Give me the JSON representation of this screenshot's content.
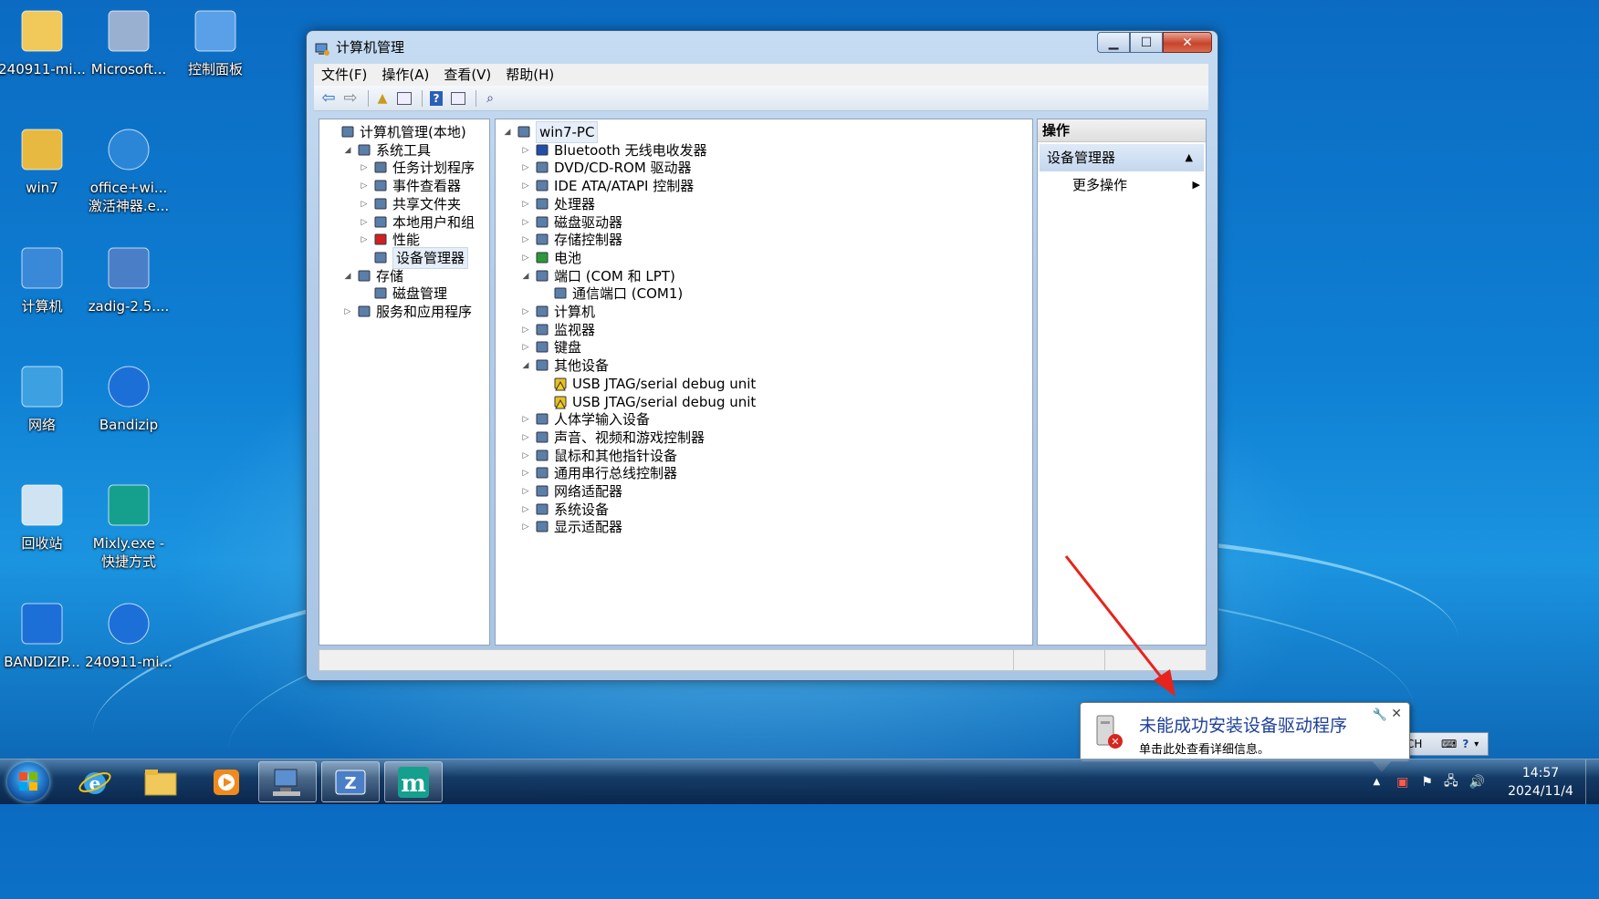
{
  "desktop": {
    "icons": [
      {
        "label": "240911-mi...",
        "icon": "folder-icon"
      },
      {
        "label": "Microsoft...",
        "icon": "cd-installer-icon"
      },
      {
        "label": "控制面板",
        "icon": "control-panel-icon"
      },
      {
        "label": "win7",
        "icon": "user-folder-icon"
      },
      {
        "label": "office+wi...",
        "label2": "激活神器.e...",
        "icon": "shield-icon"
      },
      {
        "label": "计算机",
        "icon": "computer-icon"
      },
      {
        "label": "zadig-2.5....",
        "icon": "zadig-icon"
      },
      {
        "label": "网络",
        "icon": "network-icon"
      },
      {
        "label": "Bandizip",
        "icon": "bandizip-icon"
      },
      {
        "label": "回收站",
        "icon": "recycle-bin-icon"
      },
      {
        "label": "Mixly.exe -",
        "label2": "快捷方式",
        "icon": "mixly-icon"
      },
      {
        "label": "BANDIZIP...",
        "icon": "bandizip-setup-icon"
      },
      {
        "label": "240911-mi...",
        "icon": "zip-icon"
      }
    ]
  },
  "window": {
    "title": "计算机管理",
    "menu": [
      "文件(F)",
      "操作(A)",
      "查看(V)",
      "帮助(H)"
    ],
    "left_tree": [
      {
        "label": "计算机管理(本地)",
        "level": 0,
        "expander": "",
        "icon": "computer-management-icon"
      },
      {
        "label": "系统工具",
        "level": 1,
        "expander": "◢",
        "icon": "tools-icon"
      },
      {
        "label": "任务计划程序",
        "level": 2,
        "expander": "▷",
        "icon": "clock-icon"
      },
      {
        "label": "事件查看器",
        "level": 2,
        "expander": "▷",
        "icon": "event-viewer-icon"
      },
      {
        "label": "共享文件夹",
        "level": 2,
        "expander": "▷",
        "icon": "shared-folder-icon"
      },
      {
        "label": "本地用户和组",
        "level": 2,
        "expander": "▷",
        "icon": "users-icon"
      },
      {
        "label": "性能",
        "level": 2,
        "expander": "▷",
        "icon": "performance-icon"
      },
      {
        "label": "设备管理器",
        "level": 2,
        "expander": "",
        "icon": "device-manager-icon",
        "selected": true
      },
      {
        "label": "存储",
        "level": 1,
        "expander": "◢",
        "icon": "storage-icon"
      },
      {
        "label": "磁盘管理",
        "level": 2,
        "expander": "",
        "icon": "disk-icon"
      },
      {
        "label": "服务和应用程序",
        "level": 1,
        "expander": "▷",
        "icon": "services-icon"
      }
    ],
    "device_tree": [
      {
        "label": "win7-PC",
        "level": 0,
        "expander": "◢",
        "icon": "computer-icon",
        "selected": true
      },
      {
        "label": "Bluetooth 无线电收发器",
        "level": 1,
        "expander": "▷",
        "icon": "bluetooth-icon"
      },
      {
        "label": "DVD/CD-ROM 驱动器",
        "level": 1,
        "expander": "▷",
        "icon": "dvd-drive-icon"
      },
      {
        "label": "IDE ATA/ATAPI 控制器",
        "level": 1,
        "expander": "▷",
        "icon": "ide-controller-icon"
      },
      {
        "label": "处理器",
        "level": 1,
        "expander": "▷",
        "icon": "processor-icon"
      },
      {
        "label": "磁盘驱动器",
        "level": 1,
        "expander": "▷",
        "icon": "disk-drive-icon"
      },
      {
        "label": "存储控制器",
        "level": 1,
        "expander": "▷",
        "icon": "storage-controller-icon"
      },
      {
        "label": "电池",
        "level": 1,
        "expander": "▷",
        "icon": "battery-icon"
      },
      {
        "label": "端口 (COM 和 LPT)",
        "level": 1,
        "expander": "◢",
        "icon": "port-icon"
      },
      {
        "label": "通信端口 (COM1)",
        "level": 2,
        "expander": "",
        "icon": "port-icon"
      },
      {
        "label": "计算机",
        "level": 1,
        "expander": "▷",
        "icon": "computer-icon"
      },
      {
        "label": "监视器",
        "level": 1,
        "expander": "▷",
        "icon": "monitor-icon"
      },
      {
        "label": "键盘",
        "level": 1,
        "expander": "▷",
        "icon": "keyboard-icon"
      },
      {
        "label": "其他设备",
        "level": 1,
        "expander": "◢",
        "icon": "unknown-device-icon"
      },
      {
        "label": "USB JTAG/serial debug unit",
        "level": 2,
        "expander": "",
        "icon": "warning-device-icon"
      },
      {
        "label": "USB JTAG/serial debug unit",
        "level": 2,
        "expander": "",
        "icon": "warning-device-icon"
      },
      {
        "label": "人体学输入设备",
        "level": 1,
        "expander": "▷",
        "icon": "hid-icon"
      },
      {
        "label": "声音、视频和游戏控制器",
        "level": 1,
        "expander": "▷",
        "icon": "sound-icon"
      },
      {
        "label": "鼠标和其他指针设备",
        "level": 1,
        "expander": "▷",
        "icon": "mouse-icon"
      },
      {
        "label": "通用串行总线控制器",
        "level": 1,
        "expander": "▷",
        "icon": "usb-icon"
      },
      {
        "label": "网络适配器",
        "level": 1,
        "expander": "▷",
        "icon": "network-adapter-icon"
      },
      {
        "label": "系统设备",
        "level": 1,
        "expander": "▷",
        "icon": "system-device-icon"
      },
      {
        "label": "显示适配器",
        "level": 1,
        "expander": "▷",
        "icon": "display-adapter-icon"
      }
    ],
    "actions": {
      "header": "操作",
      "section": "设备管理器",
      "more": "更多操作"
    }
  },
  "balloon": {
    "title": "未能成功安装设备驱动程序",
    "text": "单击此处查看详细信息。"
  },
  "ime": {
    "label": "CH"
  },
  "clock": {
    "time": "14:57",
    "date": "2024/11/4"
  },
  "colors": {
    "annotation_arrow": "#e8231c",
    "selection": "#e5eef9"
  }
}
